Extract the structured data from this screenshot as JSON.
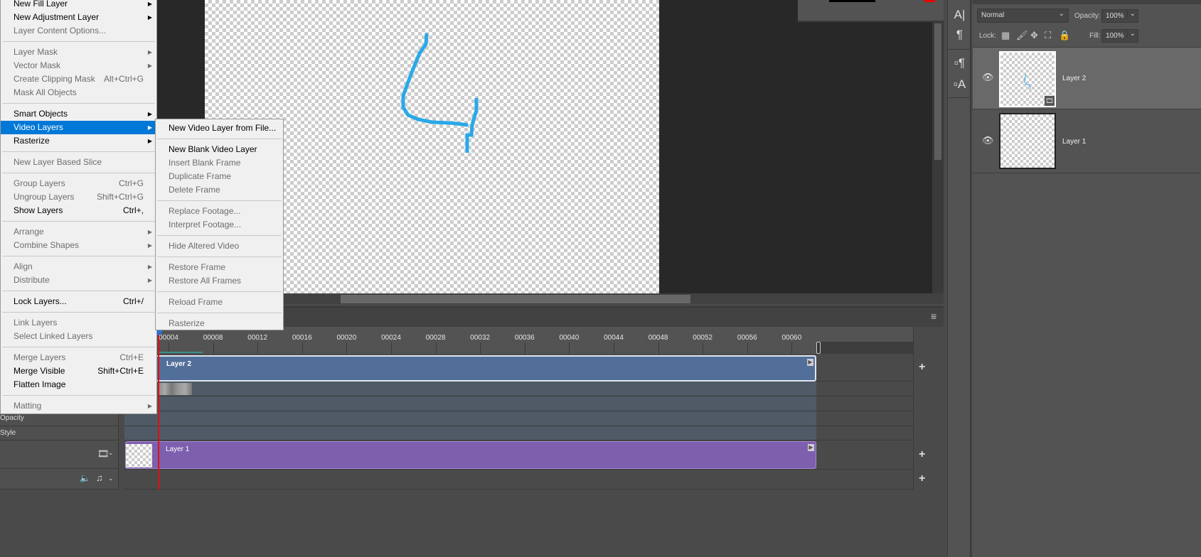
{
  "layer_menu": [
    {
      "label": "New Fill Layer",
      "submenu": true,
      "enabled": true
    },
    {
      "label": "New Adjustment Layer",
      "submenu": true,
      "enabled": true
    },
    {
      "label": "Layer Content Options...",
      "enabled": false
    },
    {
      "sep": true
    },
    {
      "label": "Layer Mask",
      "submenu": true,
      "enabled": false
    },
    {
      "label": "Vector Mask",
      "submenu": true,
      "enabled": false
    },
    {
      "label": "Create Clipping Mask",
      "shortcut": "Alt+Ctrl+G",
      "enabled": false
    },
    {
      "label": "Mask All Objects",
      "enabled": false
    },
    {
      "sep": true
    },
    {
      "label": "Smart Objects",
      "submenu": true,
      "enabled": true
    },
    {
      "label": "Video Layers",
      "submenu": true,
      "enabled": true,
      "highlighted": true
    },
    {
      "label": "Rasterize",
      "submenu": true,
      "enabled": true
    },
    {
      "sep": true
    },
    {
      "label": "New Layer Based Slice",
      "enabled": false
    },
    {
      "sep": true
    },
    {
      "label": "Group Layers",
      "shortcut": "Ctrl+G",
      "enabled": false
    },
    {
      "label": "Ungroup Layers",
      "shortcut": "Shift+Ctrl+G",
      "enabled": false
    },
    {
      "label": "Show Layers",
      "shortcut": "Ctrl+,",
      "enabled": true
    },
    {
      "sep": true
    },
    {
      "label": "Arrange",
      "submenu": true,
      "enabled": false
    },
    {
      "label": "Combine Shapes",
      "submenu": true,
      "enabled": false
    },
    {
      "sep": true
    },
    {
      "label": "Align",
      "submenu": true,
      "enabled": false
    },
    {
      "label": "Distribute",
      "submenu": true,
      "enabled": false
    },
    {
      "sep": true
    },
    {
      "label": "Lock Layers...",
      "shortcut": "Ctrl+/",
      "enabled": true
    },
    {
      "sep": true
    },
    {
      "label": "Link Layers",
      "enabled": false
    },
    {
      "label": "Select Linked Layers",
      "enabled": false
    },
    {
      "sep": true
    },
    {
      "label": "Merge Layers",
      "shortcut": "Ctrl+E",
      "enabled": false
    },
    {
      "label": "Merge Visible",
      "shortcut": "Shift+Ctrl+E",
      "enabled": true
    },
    {
      "label": "Flatten Image",
      "enabled": true
    },
    {
      "sep": true
    },
    {
      "label": "Matting",
      "submenu": true,
      "enabled": false
    }
  ],
  "video_layers_submenu": [
    {
      "label": "New Video Layer from File...",
      "enabled": true
    },
    {
      "sep": true
    },
    {
      "label": "New Blank Video Layer",
      "enabled": true
    },
    {
      "label": "Insert Blank Frame",
      "enabled": false
    },
    {
      "label": "Duplicate Frame",
      "enabled": false
    },
    {
      "label": "Delete Frame",
      "enabled": false
    },
    {
      "sep": true
    },
    {
      "label": "Replace Footage...",
      "enabled": false
    },
    {
      "label": "Interpret Footage...",
      "enabled": false
    },
    {
      "sep": true
    },
    {
      "label": "Hide Altered Video",
      "enabled": false
    },
    {
      "sep": true
    },
    {
      "label": "Restore Frame",
      "enabled": false
    },
    {
      "label": "Restore All Frames",
      "enabled": false
    },
    {
      "sep": true
    },
    {
      "label": "Reload Frame",
      "enabled": false
    },
    {
      "sep": true
    },
    {
      "label": "Rasterize",
      "enabled": false
    }
  ],
  "timeline": {
    "ruler_labels": [
      "00004",
      "00008",
      "00012",
      "00016",
      "00020",
      "00024",
      "00028",
      "00032",
      "00036",
      "00040",
      "00044",
      "00048",
      "00052",
      "00056",
      "00060"
    ],
    "track_labels": {
      "opacity": "Opacity",
      "style": "Style"
    },
    "clips": {
      "layer2": "Layer 2",
      "layer1": "Layer 1"
    },
    "add_label": "+",
    "colors": {
      "layer2_clip": "#526f9a",
      "layer1_clip": "#7d5fae",
      "playhead": "#dd1111"
    }
  },
  "layers_panel": {
    "blend_mode": "Normal",
    "opacity_label": "Opacity:",
    "opacity": "100%",
    "lock_label": "Lock:",
    "fill_label": "Fill:",
    "fill": "100%",
    "layers": [
      {
        "name": "Layer 2",
        "selected": true,
        "video": true
      },
      {
        "name": "Layer 1",
        "selected": false
      }
    ]
  },
  "colors": {
    "menu_highlight": "#0078d7",
    "stroke": "#29a8e8"
  }
}
